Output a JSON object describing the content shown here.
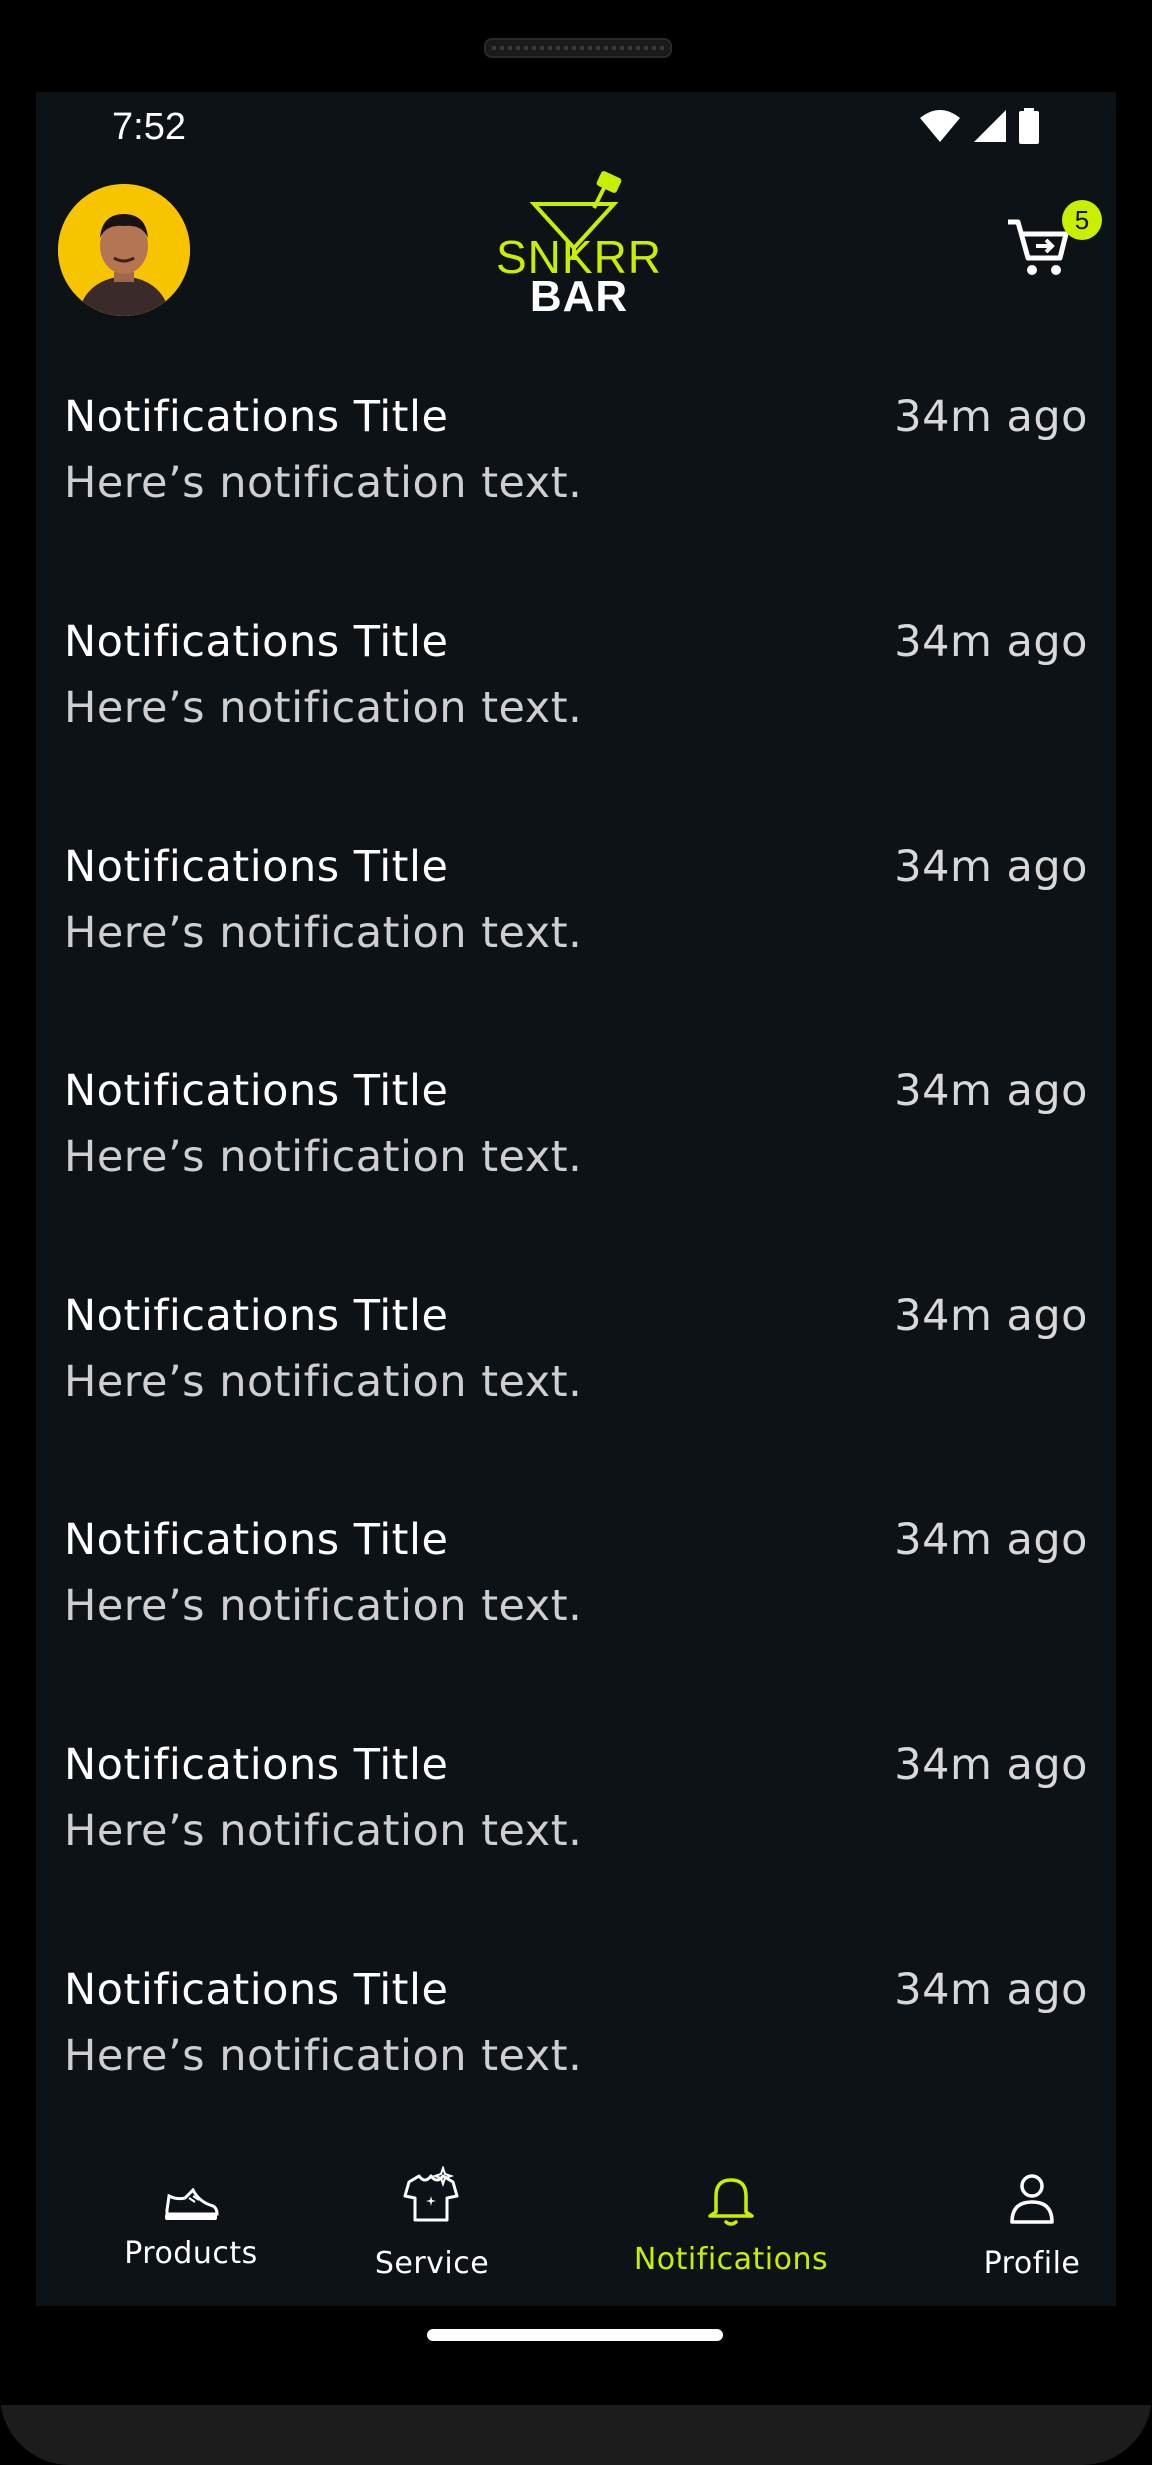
{
  "status_bar": {
    "time": "7:52"
  },
  "header": {
    "logo_text_top": "SNKRR",
    "logo_text_bottom": "BAR",
    "cart_count": "5"
  },
  "colors": {
    "background": "#0d1217",
    "accent": "#c8ef00",
    "avatar_bg": "#f7c400"
  },
  "notifications": [
    {
      "title": "Notifications Title",
      "time": "34m ago",
      "text": "Here’s notification text."
    },
    {
      "title": "Notifications Title",
      "time": "34m ago",
      "text": "Here’s notification text."
    },
    {
      "title": "Notifications Title",
      "time": "34m ago",
      "text": "Here’s notification text."
    },
    {
      "title": "Notifications Title",
      "time": "34m ago",
      "text": "Here’s notification text."
    },
    {
      "title": "Notifications Title",
      "time": "34m ago",
      "text": "Here’s notification text."
    },
    {
      "title": "Notifications Title",
      "time": "34m ago",
      "text": "Here’s notification text."
    },
    {
      "title": "Notifications Title",
      "time": "34m ago",
      "text": "Here’s notification text."
    },
    {
      "title": "Notifications Title",
      "time": "34m ago",
      "text": "Here’s notification text."
    }
  ],
  "bottom_nav": {
    "items": [
      {
        "label": "Products",
        "icon": "sneaker-icon",
        "active": false
      },
      {
        "label": "Service",
        "icon": "shirt-sparkle-icon",
        "active": false
      },
      {
        "label": "Notifications",
        "icon": "bell-icon",
        "active": true
      },
      {
        "label": "Profile",
        "icon": "person-icon",
        "active": false
      }
    ]
  }
}
